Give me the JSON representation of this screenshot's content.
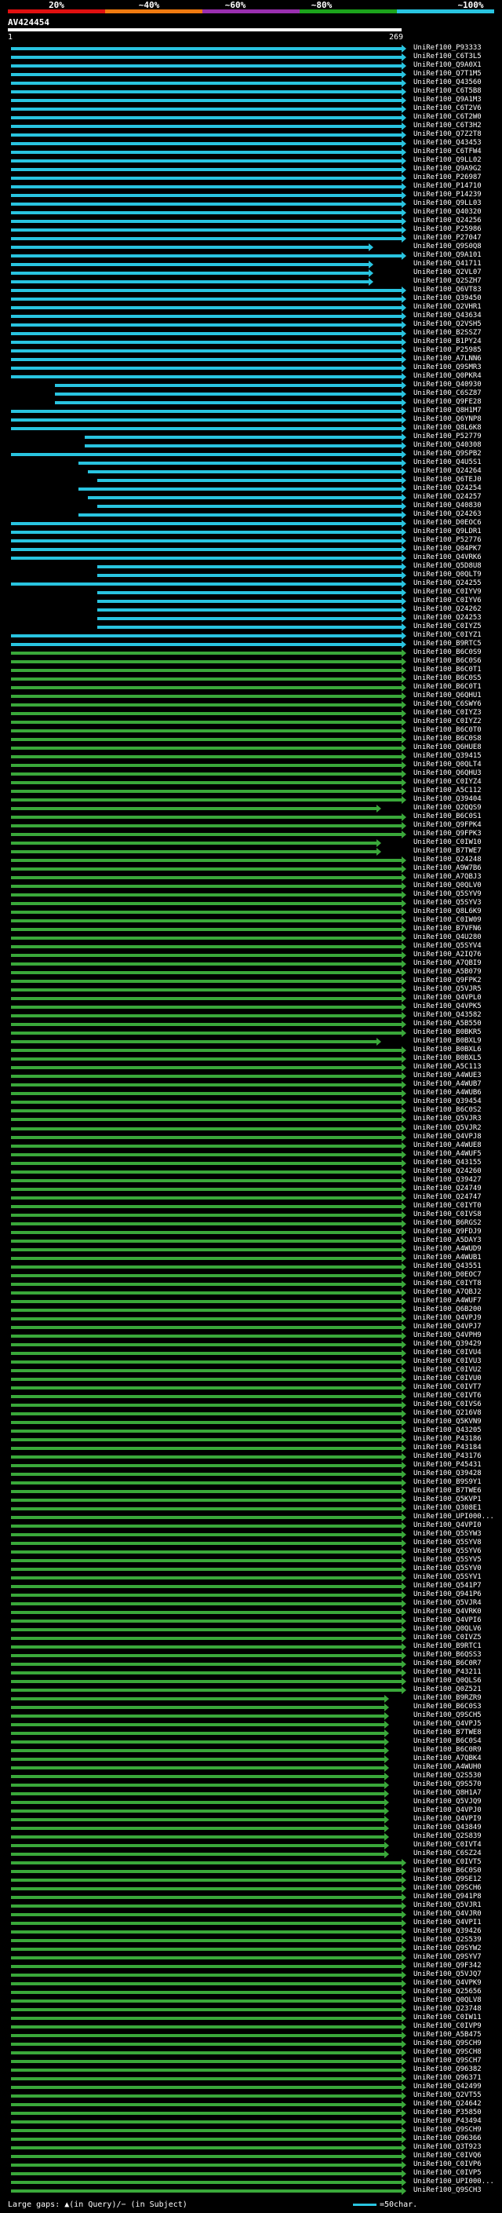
{
  "legend": {
    "ticks": [
      "20%",
      "~40%",
      "~60%",
      "~80%",
      "~100%"
    ],
    "colors": [
      "#e01010",
      "#f07a10",
      "#9a2fb0",
      "#1ca31c",
      "#29c4e0"
    ]
  },
  "query": {
    "name": "AV424454",
    "start": "1",
    "end": "269"
  },
  "colors": {
    "cyan": "#29c4e0",
    "green": "#3aa83a"
  },
  "hits": [
    "UniRef100_P93333",
    "UniRef100_C6T3L5",
    "UniRef100_Q9A0X1",
    "UniRef100_Q7T1M5",
    "UniRef100_Q43560",
    "UniRef100_C6T5B8",
    "UniRef100_Q9A1M3",
    "UniRef100_C6T2V6",
    "UniRef100_C6T2W0",
    "UniRef100_C6T3H2",
    "UniRef100_Q7Z2T8",
    "UniRef100_Q43453",
    "UniRef100_C6TFW4",
    "UniRef100_Q9LL02",
    "UniRef100_Q9A9G2",
    "UniRef100_P26987",
    "UniRef100_P14710",
    "UniRef100_P14239",
    "UniRef100_Q9LL03",
    "UniRef100_Q40320",
    "UniRef100_Q24256",
    "UniRef100_P25986",
    "UniRef100_P27047",
    "UniRef100_Q9S0Q8",
    "UniRef100_Q9A101",
    "UniRef100_Q41711",
    "UniRef100_Q2VL07",
    "UniRef100_Q2SZH7",
    "UniRef100_Q6VT83",
    "UniRef100_Q39450",
    "UniRef100_Q2VHR1",
    "UniRef100_Q43634",
    "UniRef100_Q2VSH5",
    "UniRef100_B2SSZ7",
    "UniRef100_B1PY24",
    "UniRef100_P25985",
    "UniRef100_A7LNN6",
    "UniRef100_Q9SMR3",
    "UniRef100_Q0PKR4",
    "UniRef100_Q40930",
    "UniRef100_C6SZ87",
    "UniRef100_Q9FE28",
    "UniRef100_Q8H1M7",
    "UniRef100_Q6YNP8",
    "UniRef100_Q8L6K8",
    "UniRef100_P52779",
    "UniRef100_Q40308",
    "UniRef100_Q9SPB2",
    "UniRef100_Q4U5S1",
    "UniRef100_Q24264",
    "UniRef100_Q6TEJ0",
    "UniRef100_Q24254",
    "UniRef100_Q24257",
    "UniRef100_Q40830",
    "UniRef100_Q24263",
    "UniRef100_D0EOC6",
    "UniRef100_Q9LDR1",
    "UniRef100_P52776",
    "UniRef100_Q04PK7",
    "UniRef100_Q4VRK6",
    "UniRef100_Q5D8U8",
    "UniRef100_Q0QLT9",
    "UniRef100_Q24255",
    "UniRef100_C0IYV9",
    "UniRef100_C0IYV6",
    "UniRef100_Q24262",
    "UniRef100_Q24253",
    "UniRef100_C0IYZ5",
    "UniRef100_C0IYZ1",
    "UniRef100_B9RTC5",
    "UniRef100_B6C0S9",
    "UniRef100_B6C0S6",
    "UniRef100_B6C0T1",
    "UniRef100_B6C0S5",
    "UniRef100_B6C0T1",
    "UniRef100_Q6QHU1",
    "UniRef100_C6SWY6",
    "UniRef100_C0IYZ3",
    "UniRef100_C0IYZ2",
    "UniRef100_B6C0T0",
    "UniRef100_B6C0S8",
    "UniRef100_Q6HUE8",
    "UniRef100_Q39415",
    "UniRef100_Q0QLT4",
    "UniRef100_Q6QHU3",
    "UniRef100_C0IYZ4",
    "UniRef100_A5C112",
    "UniRef100_Q39404",
    "UniRef100_Q2QQS9",
    "UniRef100_B6C0S1",
    "UniRef100_Q9FPK4",
    "UniRef100_Q9FPK3",
    "UniRef100_C0IW10",
    "UniRef100_B7TWE7",
    "UniRef100_Q24248",
    "UniRef100_A9W7B6",
    "UniRef100_A7QBJ3",
    "UniRef100_Q0QLV0",
    "UniRef100_Q5SYV9",
    "UniRef100_Q5SYV3",
    "UniRef100_Q8L6K9",
    "UniRef100_C0IW09",
    "UniRef100_B7VFN6",
    "UniRef100_Q4U280",
    "UniRef100_Q5SYV4",
    "UniRef100_A2IQ76",
    "UniRef100_A7QBI9",
    "UniRef100_A5B079",
    "UniRef100_Q9FPK2",
    "UniRef100_Q5VJR5",
    "UniRef100_Q4VPL0",
    "UniRef100_Q4VPK5",
    "UniRef100_Q43582",
    "UniRef100_A5B550",
    "UniRef100_B0BKR5",
    "UniRef100_B0BXL9",
    "UniRef100_B0BXL6",
    "UniRef100_B0BXL5",
    "UniRef100_A5C113",
    "UniRef100_A4WUE3",
    "UniRef100_A4WUB7",
    "UniRef100_A4WUB6",
    "UniRef100_Q39454",
    "UniRef100_B6C0S2",
    "UniRef100_Q5VJR3",
    "UniRef100_Q5VJR2",
    "UniRef100_Q4VPJ8",
    "UniRef100_A4WUE8",
    "UniRef100_A4WUF5",
    "UniRef100_Q43155",
    "UniRef100_Q24260",
    "UniRef100_Q39427",
    "UniRef100_Q24749",
    "UniRef100_Q24747",
    "UniRef100_C0IYT0",
    "UniRef100_C0IVS8",
    "UniRef100_B6RGS2",
    "UniRef100_Q9FDJ9",
    "UniRef100_A5DAY3",
    "UniRef100_A4WUD9",
    "UniRef100_A4WUB1",
    "UniRef100_Q43551",
    "UniRef100_D0EOC7",
    "UniRef100_C0IYT8",
    "UniRef100_A7QBJ2",
    "UniRef100_A4WUF7",
    "UniRef100_Q6B200",
    "UniRef100_Q4VPJ9",
    "UniRef100_Q4VPJ7",
    "UniRef100_Q4VPH9",
    "UniRef100_Q39429",
    "UniRef100_C0IVU4",
    "UniRef100_C0IVU3",
    "UniRef100_C0IVU2",
    "UniRef100_C0IVU0",
    "UniRef100_C0IVT7",
    "UniRef100_C0IVT6",
    "UniRef100_C0IVS6",
    "UniRef100_Q216V8",
    "UniRef100_Q5KVN9",
    "UniRef100_Q43205",
    "UniRef100_P43186",
    "UniRef100_P43184",
    "UniRef100_P43176",
    "UniRef100_P45431",
    "UniRef100_Q39428",
    "UniRef100_B9S9Y1",
    "UniRef100_B7TWE6",
    "UniRef100_Q5KVP1",
    "UniRef100_Q308E1",
    "UniRef100_UPI000...",
    "UniRef100_Q4VPI0",
    "UniRef100_Q5SYW3",
    "UniRef100_Q5SYV8",
    "UniRef100_Q5SYV6",
    "UniRef100_Q5SYV5",
    "UniRef100_Q5SYV0",
    "UniRef100_Q5SYV1",
    "UniRef100_Q541P7",
    "UniRef100_Q941P6",
    "UniRef100_Q5VJR4",
    "UniRef100_Q4VRK0",
    "UniRef100_Q4VPI6",
    "UniRef100_Q0QLV6",
    "UniRef100_C0IVZ5",
    "UniRef100_B9RTC1",
    "UniRef100_B6QSS3",
    "UniRef100_B6C0R7",
    "UniRef100_P43211",
    "UniRef100_Q0QLS6",
    "UniRef100_Q0Z521",
    "UniRef100_B9RZR9",
    "UniRef100_B6C0S3",
    "UniRef100_Q9SCH5",
    "UniRef100_Q4VPJ5",
    "UniRef100_B7TWE8",
    "UniRef100_B6C0S4",
    "UniRef100_B6C0R9",
    "UniRef100_A7QBK4",
    "UniRef100_A4WUH0",
    "UniRef100_Q2S530",
    "UniRef100_Q9S570",
    "UniRef100_Q8H1A7",
    "UniRef100_Q5VJQ9",
    "UniRef100_Q4VPJ0",
    "UniRef100_Q4VPI9",
    "UniRef100_Q43849",
    "UniRef100_Q2S839",
    "UniRef100_C0IVT4",
    "UniRef100_C6SZ24",
    "UniRef100_C0IVT5",
    "UniRef100_B6C0S0",
    "UniRef100_Q9SE12",
    "UniRef100_Q9SCH6",
    "UniRef100_Q941P8",
    "UniRef100_Q5VJR1",
    "UniRef100_Q4VJR0",
    "UniRef100_Q4VPI1",
    "UniRef100_Q39426",
    "UniRef100_Q2S539",
    "UniRef100_Q9SYW2",
    "UniRef100_Q9SYV7",
    "UniRef100_Q9F342",
    "UniRef100_Q5VJQ7",
    "UniRef100_Q4VPK9",
    "UniRef100_Q25656",
    "UniRef100_Q0QLV8",
    "UniRef100_Q23748",
    "UniRef100_C0IW11",
    "UniRef100_C0IVP9",
    "UniRef100_A5B475",
    "UniRef100_Q9SCH9",
    "UniRef100_Q9SCH8",
    "UniRef100_Q9SCH7",
    "UniRef100_Q96382",
    "UniRef100_Q96371",
    "UniRef100_Q42499",
    "UniRef100_Q2VT55",
    "UniRef100_Q24642",
    "UniRef100_P35850",
    "UniRef100_P43494",
    "UniRef100_Q9SCH9",
    "UniRef100_Q96366",
    "UniRef100_Q3T923",
    "UniRef100_C0IVQ6",
    "UniRef100_C0IVP6",
    "UniRef100_C0IVP5",
    "UniRef100_UPI000...",
    "UniRef100_Q9SCH3"
  ],
  "footer": {
    "large_gaps": "Large gaps: ▲(in Query)/− (in Subject)",
    "scale": "=50char."
  }
}
